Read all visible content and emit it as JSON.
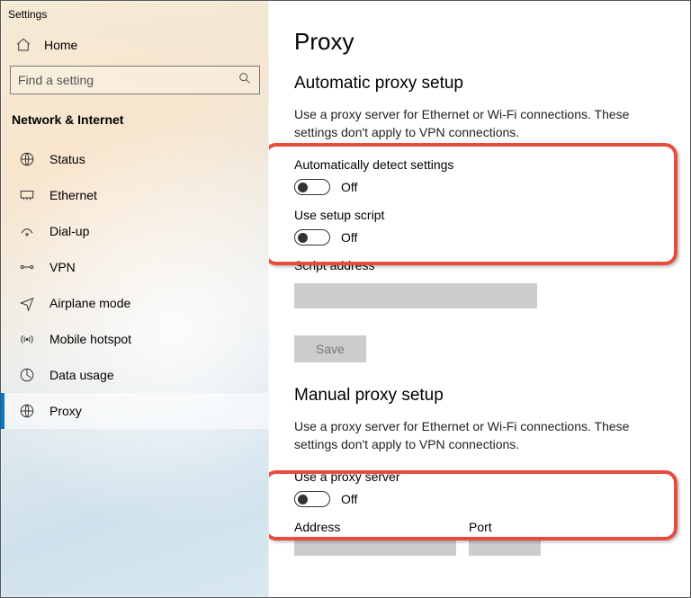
{
  "app_title": "Settings",
  "home_label": "Home",
  "search_placeholder": "Find a setting",
  "category": "Network & Internet",
  "nav": [
    {
      "label": "Status"
    },
    {
      "label": "Ethernet"
    },
    {
      "label": "Dial-up"
    },
    {
      "label": "VPN"
    },
    {
      "label": "Airplane mode"
    },
    {
      "label": "Mobile hotspot"
    },
    {
      "label": "Data usage"
    },
    {
      "label": "Proxy"
    }
  ],
  "page": {
    "title": "Proxy",
    "auto": {
      "heading": "Automatic proxy setup",
      "desc": "Use a proxy server for Ethernet or Wi-Fi connections. These settings don't apply to VPN connections.",
      "detect_label": "Automatically detect settings",
      "detect_state": "Off",
      "script_label": "Use setup script",
      "script_state": "Off",
      "address_label": "Script address",
      "save_label": "Save"
    },
    "manual": {
      "heading": "Manual proxy setup",
      "desc": "Use a proxy server for Ethernet or Wi-Fi connections. These settings don't apply to VPN connections.",
      "use_label": "Use a proxy server",
      "use_state": "Off",
      "address_label": "Address",
      "port_label": "Port"
    }
  }
}
